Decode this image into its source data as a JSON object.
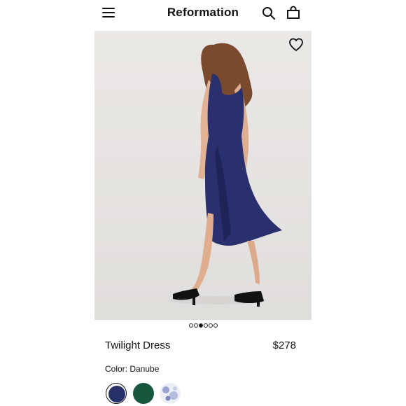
{
  "header": {
    "brand": "Reformation",
    "icons": [
      "menu-icon",
      "search-icon",
      "bag-icon"
    ]
  },
  "gallery": {
    "image_count": 6,
    "active_index": 2,
    "favorite_icon": "heart-outline-icon"
  },
  "product": {
    "name": "Twilight Dress",
    "price": "$278",
    "color_label": "Color: Danube"
  },
  "swatches": [
    {
      "color": "#28306a",
      "selected": true
    },
    {
      "color": "#17573f",
      "selected": false
    },
    {
      "color": "#c9cde4",
      "selected": false,
      "pattern": "floral"
    }
  ],
  "colors": {
    "dress": "#2a2f6e",
    "background": "#e6e5e4",
    "text": "#111111"
  }
}
